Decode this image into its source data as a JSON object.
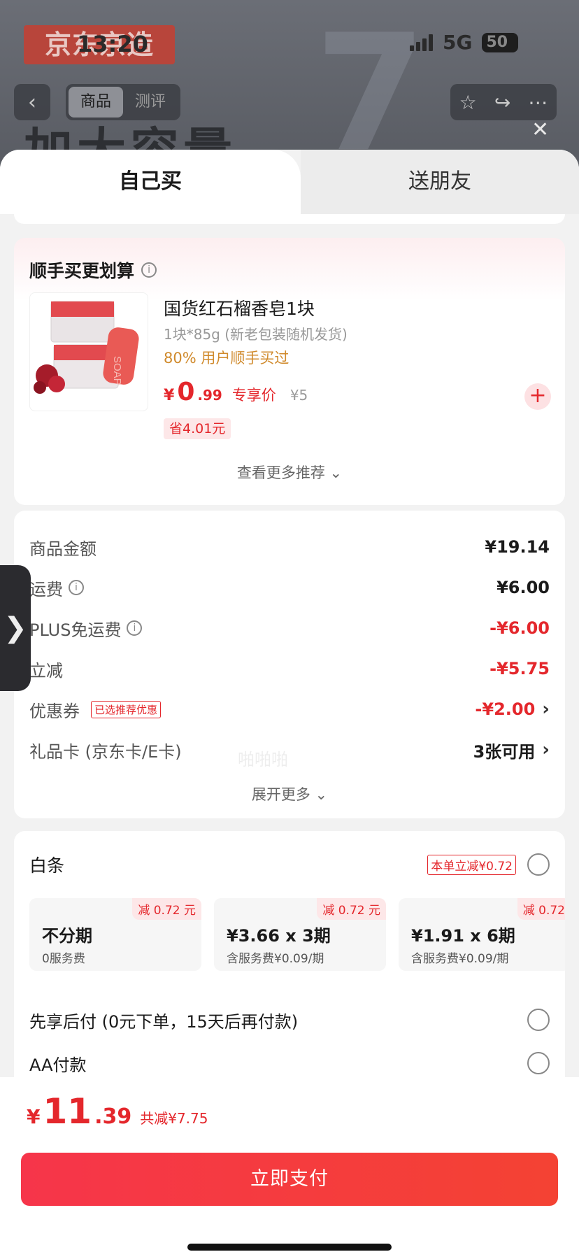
{
  "status_bar": {
    "time": "13:20",
    "network": "5G",
    "battery": "50"
  },
  "background_page": {
    "banner": "京东京造",
    "big_text": "加大容量",
    "tabs": [
      "商品",
      "测评"
    ],
    "back_icon": "chevron-left-icon",
    "actions": [
      "star-icon",
      "share-icon",
      "more-icon"
    ]
  },
  "sheet": {
    "close_icon": "close-icon",
    "tabs": [
      {
        "label": "自己买",
        "active": true
      },
      {
        "label": "送朋友",
        "active": false
      }
    ]
  },
  "recommend": {
    "title": "顺手买更划算",
    "product": {
      "name": "国货红石榴香皂1块",
      "spec": "1块*85g (新老包装随机发货)",
      "hint": "80% 用户顺手买过",
      "price_currency": "¥",
      "price_int": "0",
      "price_dec": ".99",
      "price_tag": "专享价",
      "original_price": "¥5",
      "save": "省4.01元",
      "image_text": "SOAP"
    },
    "more": "查看更多推荐"
  },
  "amounts": {
    "rows": [
      {
        "label": "商品金额",
        "value": "¥19.14",
        "red": false,
        "info": false,
        "arrow": false
      },
      {
        "label": "运费",
        "value": "¥6.00",
        "red": false,
        "info": true,
        "arrow": false
      },
      {
        "label": "PLUS免运费",
        "value": "-¥6.00",
        "red": true,
        "info": true,
        "arrow": false
      },
      {
        "label": "立减",
        "value": "-¥5.75",
        "red": true,
        "info": false,
        "arrow": false
      },
      {
        "label": "优惠券",
        "value": "-¥2.00",
        "red": true,
        "info": false,
        "arrow": true,
        "tag": "已选推荐优惠"
      },
      {
        "label": "礼品卡 (京东卡/E卡)",
        "value": "3张可用",
        "red": false,
        "info": false,
        "arrow": true
      }
    ],
    "expand": "展开更多"
  },
  "payment": {
    "baitiao_label": "白条",
    "baitiao_tag": "本单立减¥0.72",
    "plans": [
      {
        "discount": "减 0.72 元",
        "title": "不分期",
        "sub": "0服务费"
      },
      {
        "discount": "减 0.72 元",
        "title": "¥3.66 x 3期",
        "sub": "含服务费¥0.09/期"
      },
      {
        "discount": "减 0.72",
        "title": "¥1.91 x 6期",
        "sub": "含服务费¥0.09/期"
      }
    ],
    "pay_later": "先享后付 (0元下单，15天后再付款)",
    "aa_pay": "AA付款"
  },
  "bottom": {
    "total_currency": "¥",
    "total_int": "11",
    "total_dec": ".39",
    "total_save": "共减¥7.75",
    "pay_button": "立即支付"
  },
  "colors": {
    "accent": "#e4272c",
    "pay_button": "#f6354a"
  },
  "side_handle_icon": "chevron-right-icon"
}
